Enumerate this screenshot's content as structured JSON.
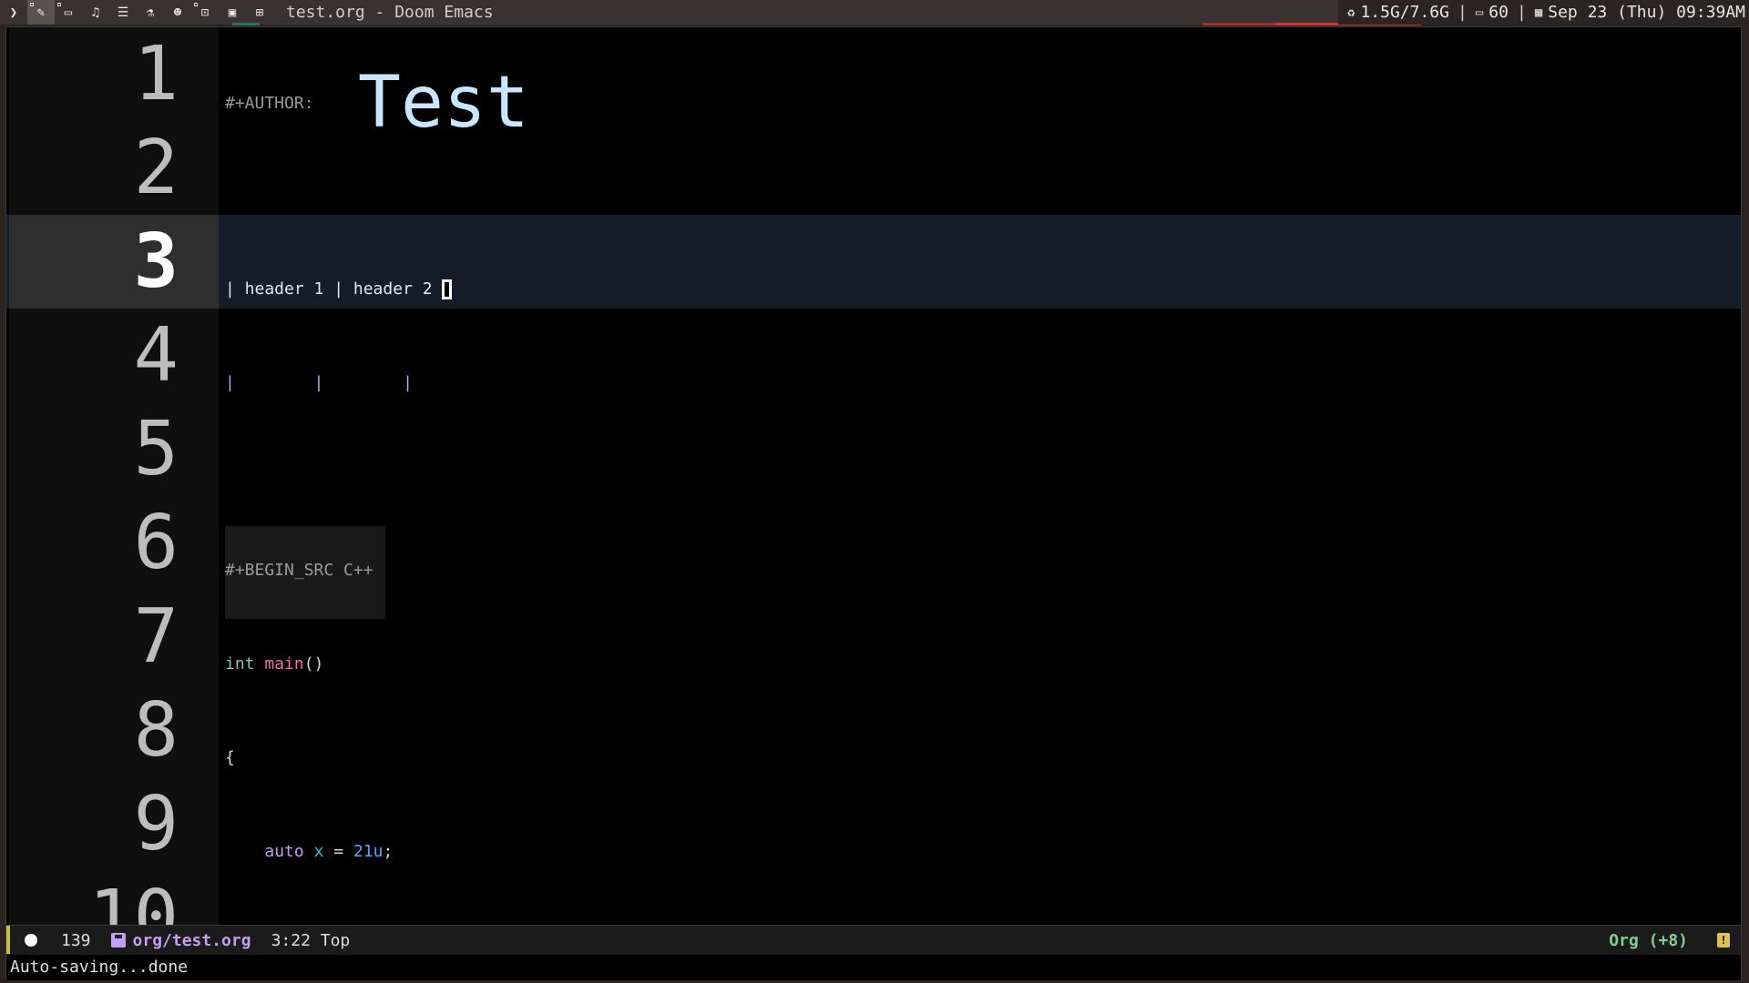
{
  "topbar": {
    "workspace_icons": [
      "chevron-right-icon",
      "pencil-icon",
      "monitor-icon",
      "music-icon",
      "server-icon",
      "flask-icon",
      "users-icon",
      "lock-icon",
      "trash-icon",
      "grid-icon"
    ],
    "window_title": "test.org - Doom Emacs",
    "memory": "1.5G/7.6G",
    "separator": "|",
    "battery": "60",
    "datetime": "Sep 23 (Thu) 09:39AM"
  },
  "editor": {
    "title_text": "Test",
    "lines": [
      {
        "num": "1",
        "author_keyword": "#+AUTHOR:"
      },
      {
        "num": "2"
      },
      {
        "num": "3",
        "table_header": "| header 1 | header 2 "
      },
      {
        "num": "4",
        "table_row_pipes": "|        |        |"
      },
      {
        "num": "5"
      },
      {
        "num": "6",
        "src_begin": "#+BEGIN_SRC C++"
      },
      {
        "num": "7",
        "type": "int",
        "fn": "main",
        "punct": "()"
      },
      {
        "num": "8",
        "brace": "{"
      },
      {
        "num": "9",
        "auto_kw": "auto",
        "var": "x",
        "eq": " = ",
        "num_lit": "21u",
        "semi": ";"
      },
      {
        "num": "10"
      }
    ],
    "current_line": "3"
  },
  "modeline": {
    "line_count": "139",
    "file": "org/test.org",
    "position": "3:22 Top",
    "major_mode": "Org (+8)",
    "warning_glyph": "!"
  },
  "echo": {
    "message": "Auto-saving...done"
  },
  "colors": {
    "background": "#000000",
    "gutter": "#0f0f0f",
    "current_line": "#141b29",
    "title": "#c8e6ff",
    "mode_green": "#7fd08c",
    "file_purple": "#c59df2"
  }
}
